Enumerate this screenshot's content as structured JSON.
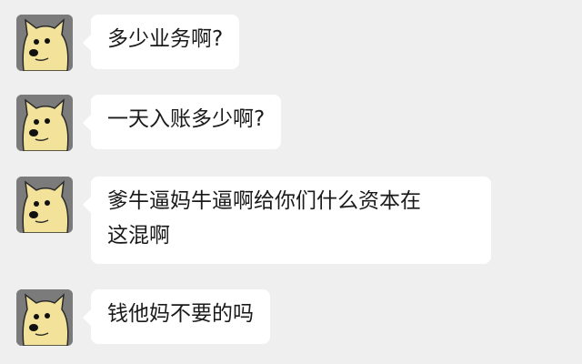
{
  "chat": {
    "avatar_icon": "doge-avatar-icon",
    "messages": [
      {
        "text": "多少业务啊?"
      },
      {
        "text": "一天入账多少啊?"
      },
      {
        "text": "爹牛逼妈牛逼啊给你们什么资本在\n这混啊"
      },
      {
        "text": "钱他妈不要的吗"
      }
    ]
  }
}
